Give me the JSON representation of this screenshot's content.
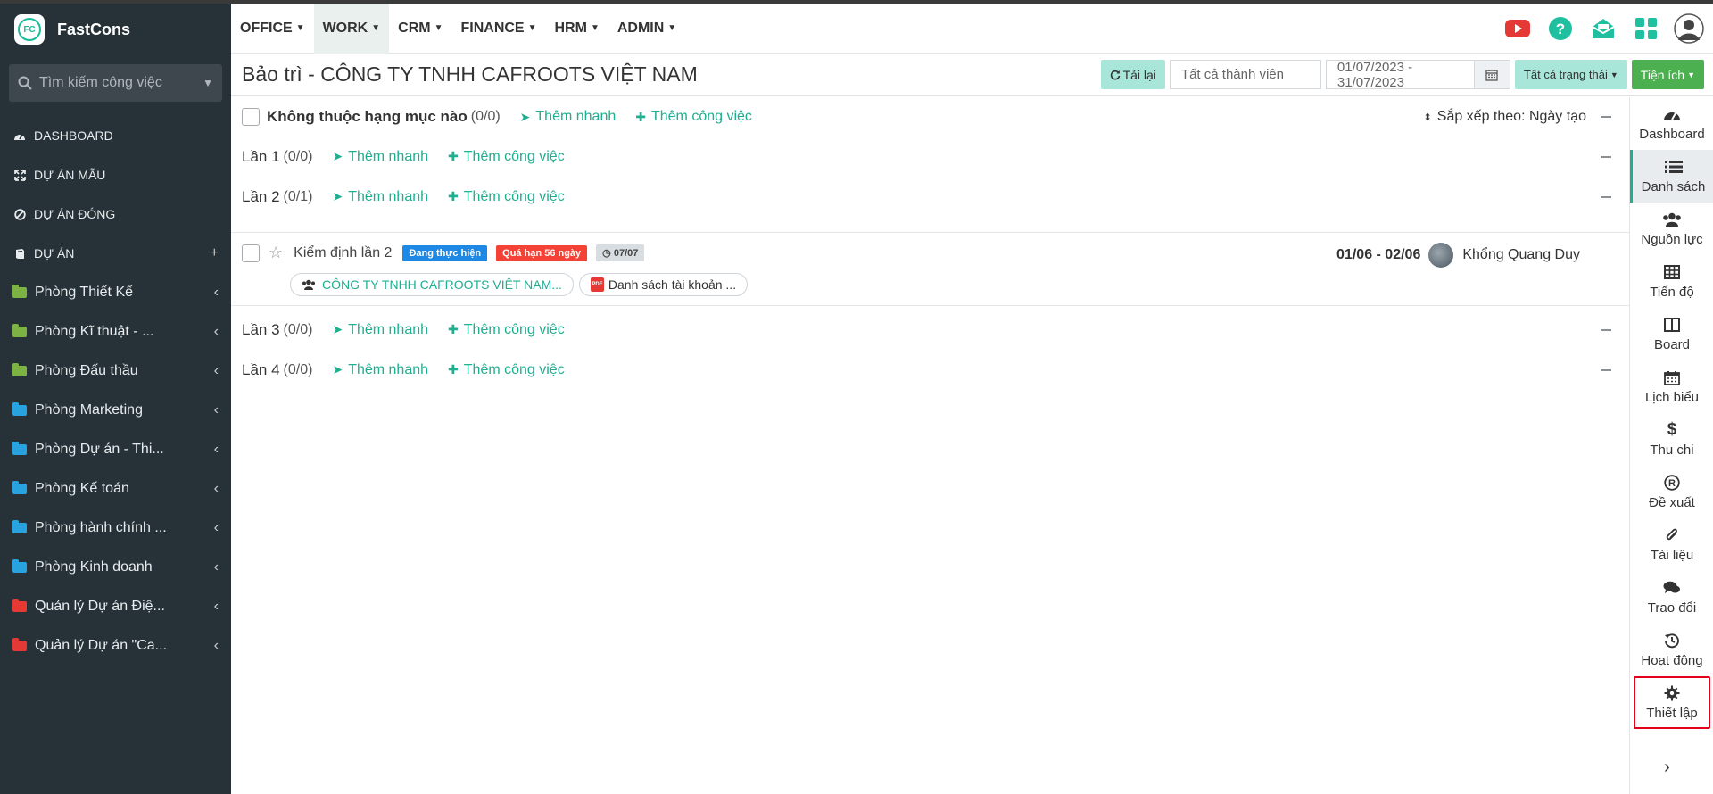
{
  "app": {
    "name": "FastCons",
    "logo_text": "FC"
  },
  "sidebar": {
    "search_placeholder": "Tìm kiếm công việc",
    "items": [
      {
        "label": "DASHBOARD",
        "icon": "dashboard-icon"
      },
      {
        "label": "DỰ ÁN MẪU",
        "icon": "expand-icon"
      },
      {
        "label": "DỰ ÁN ĐÓNG",
        "icon": "ban-icon"
      },
      {
        "label": "DỰ ÁN",
        "icon": "book-icon",
        "trail": "+"
      }
    ],
    "folders": [
      {
        "label": "Phòng Thiết Kế",
        "color": "#7cb342"
      },
      {
        "label": "Phòng Kĩ thuật - ...",
        "color": "#7cb342"
      },
      {
        "label": "Phòng Đấu thầu",
        "color": "#7cb342"
      },
      {
        "label": "Phòng Marketing",
        "color": "#29a3e0"
      },
      {
        "label": "Phòng Dự án - Thi...",
        "color": "#29a3e0"
      },
      {
        "label": "Phòng Kế toán",
        "color": "#29a3e0"
      },
      {
        "label": "Phòng hành chính ...",
        "color": "#29a3e0"
      },
      {
        "label": "Phòng Kinh doanh",
        "color": "#29a3e0"
      },
      {
        "label": "Quản lý Dự án Điệ...",
        "color": "#e53935"
      },
      {
        "label": "Quản lý Dự án \"Ca...",
        "color": "#e53935"
      }
    ]
  },
  "topnav": {
    "menus": [
      "OFFICE",
      "WORK",
      "CRM",
      "FINANCE",
      "HRM",
      "ADMIN"
    ],
    "active": "WORK"
  },
  "header": {
    "title": "Bảo trì - CÔNG TY TNHH CAFROOTS VIỆT NAM",
    "reload_label": "Tải lại",
    "member_filter": "Tất cả thành viên",
    "date_range": "01/07/2023 - 31/07/2023",
    "status_filter": "Tất cả trạng thái",
    "utilities_label": "Tiện ích"
  },
  "main": {
    "sort_label": "Sắp xếp theo: Ngày tạo",
    "quick_add": "Thêm nhanh",
    "add_task": "Thêm công việc",
    "groups": [
      {
        "name": "Không thuộc hạng mục nào",
        "count": "(0/0)"
      },
      {
        "name": "Lần 1",
        "count": "(0/0)"
      },
      {
        "name": "Lần 2",
        "count": "(0/1)"
      },
      {
        "name": "Lần 3",
        "count": "(0/0)"
      },
      {
        "name": "Lần 4",
        "count": "(0/0)"
      }
    ],
    "task": {
      "name": "Kiểm định lần 2",
      "status": "Đang thực hiện",
      "overdue": "Quá hạn 56 ngày",
      "due": "07/07",
      "customer": "CÔNG TY TNHH CAFROOTS VIỆT NAM...",
      "attachment": "Danh sách tài khoản ...",
      "dates": "01/06 - 02/06",
      "assignee": "Khổng Quang Duy"
    }
  },
  "rail": {
    "items": [
      "Dashboard",
      "Danh sách",
      "Nguồn lực",
      "Tiến độ",
      "Board",
      "Lịch biểu",
      "Thu chi",
      "Đề xuất",
      "Tài liệu",
      "Trao đổi",
      "Hoạt động",
      "Thiết lập"
    ],
    "active": "Danh sách",
    "chevron": "›"
  },
  "colors": {
    "accent": "#1fae8f",
    "sidebar_bg": "#263238",
    "utilities_btn": "#4caf50",
    "highlight_box": "#e2001a"
  }
}
